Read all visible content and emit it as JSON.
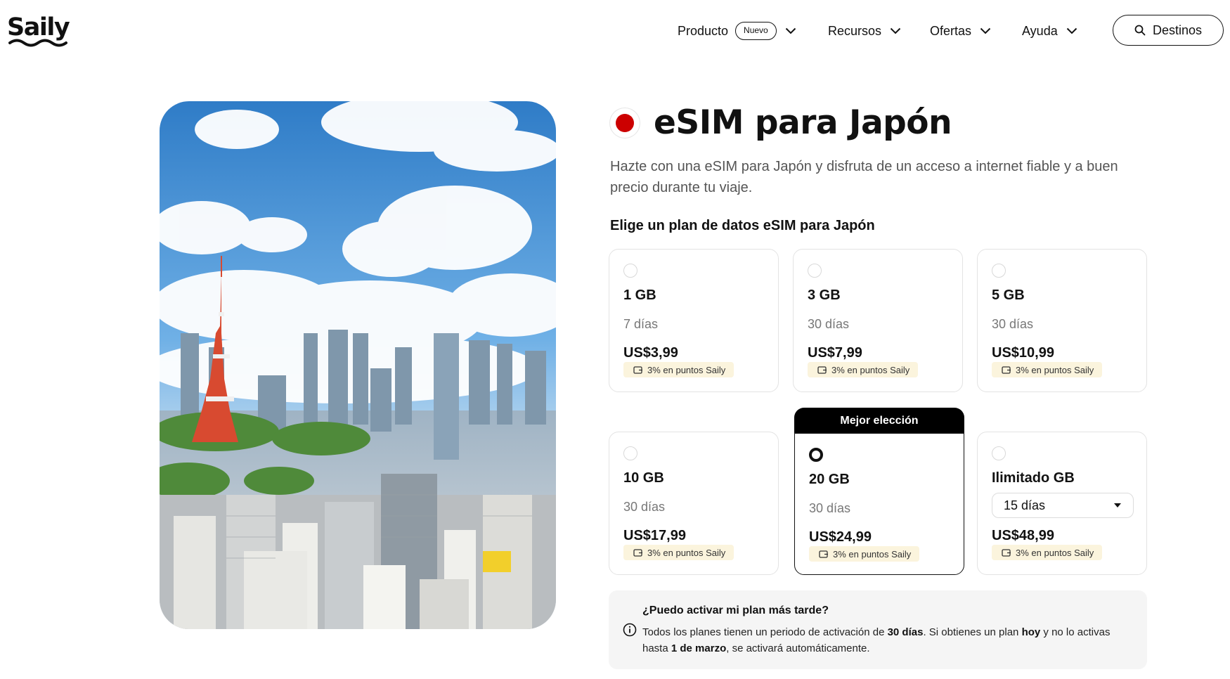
{
  "header": {
    "logo": "Saily",
    "nav": [
      {
        "label": "Producto",
        "badge": "Nuevo"
      },
      {
        "label": "Recursos"
      },
      {
        "label": "Ofertas"
      },
      {
        "label": "Ayuda"
      }
    ],
    "search_button": "Destinos"
  },
  "product": {
    "title": "eSIM para Japón",
    "subtitle": "Hazte con una eSIM para Japón y disfruta de un acceso a internet fiable y a buen precio durante tu viaje.",
    "plans_heading": "Elige un plan de datos eSIM para Japón",
    "best_choice_label": "Mejor elección",
    "plans": [
      {
        "data": "1 GB",
        "days": "7 días",
        "price": "US$3,99",
        "points": "3% en puntos Saily",
        "selected": false
      },
      {
        "data": "3 GB",
        "days": "30 días",
        "price": "US$7,99",
        "points": "3% en puntos Saily",
        "selected": false
      },
      {
        "data": "5 GB",
        "days": "30 días",
        "price": "US$10,99",
        "points": "3% en puntos Saily",
        "selected": false
      },
      {
        "data": "10 GB",
        "days": "30 días",
        "price": "US$17,99",
        "points": "3% en puntos Saily",
        "selected": false
      },
      {
        "data": "20 GB",
        "days": "30 días",
        "price": "US$24,99",
        "points": "3% en puntos Saily",
        "selected": true
      },
      {
        "data": "Ilimitado GB",
        "days": "15 días",
        "price": "US$48,99",
        "points": "3% en puntos Saily",
        "selected": false
      }
    ]
  },
  "info": {
    "question": "¿Puedo activar mi plan más tarde?",
    "answer_1": "Todos los planes tienen un periodo de activación de ",
    "answer_2": "30 días",
    "answer_3": ". Si obtienes un plan ",
    "answer_4": "hoy",
    "answer_5": " y no lo activas hasta ",
    "answer_6": "1 de marzo",
    "answer_7": ", se activará automáticamente."
  },
  "colors": {
    "flag_red": "#cc0000",
    "points_bg": "#fbf4dd",
    "info_bg": "#f5f5f5"
  }
}
